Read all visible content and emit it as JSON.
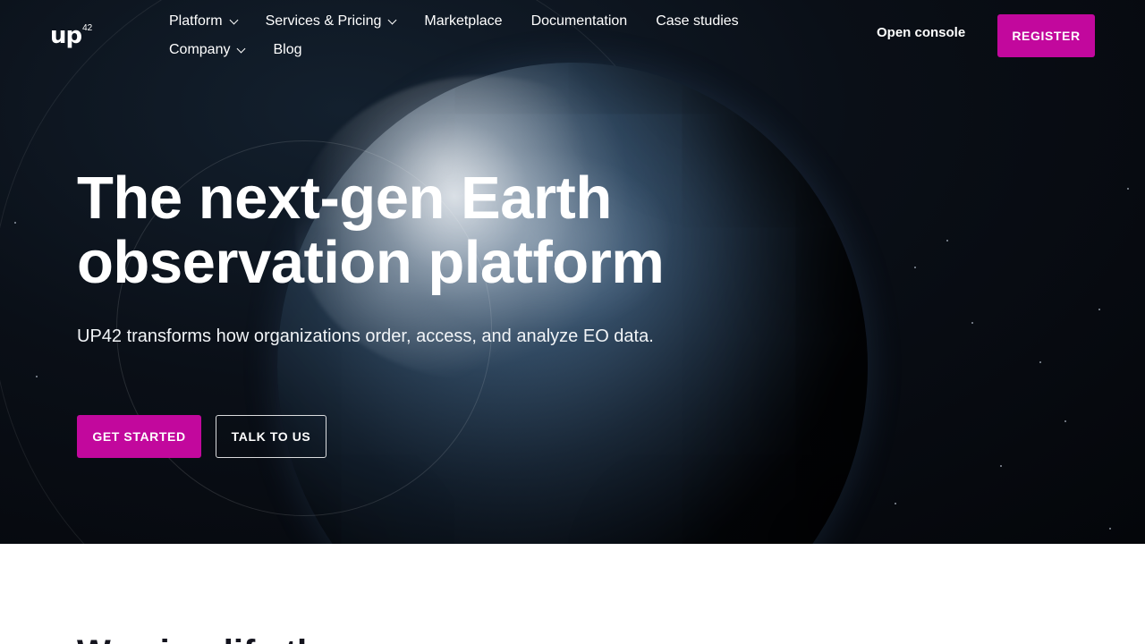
{
  "brand": {
    "logo_text": "up",
    "logo_superscript": "42"
  },
  "nav": {
    "row1": [
      {
        "label": "Platform",
        "dropdown": true
      },
      {
        "label": "Services & Pricing",
        "dropdown": true
      },
      {
        "label": "Marketplace",
        "dropdown": false
      },
      {
        "label": "Documentation",
        "dropdown": false
      },
      {
        "label": "Case studies",
        "dropdown": false
      }
    ],
    "row2": [
      {
        "label": "Company",
        "dropdown": true
      },
      {
        "label": "Blog",
        "dropdown": false
      }
    ]
  },
  "header_actions": {
    "open_console": "Open console",
    "register": "REGISTER"
  },
  "hero": {
    "headline_line1": "The next-gen Earth",
    "headline_line2": "observation platform",
    "subheading": "UP42 transforms how organizations order, access, and analyze EO data.",
    "cta_primary": "GET STARTED",
    "cta_secondary": "TALK TO US"
  },
  "next_section": {
    "title_partial": "We simplify the"
  },
  "colors": {
    "accent": "#c2089d",
    "hero_bg": "#0a0f17",
    "page_bg": "#ffffff"
  }
}
